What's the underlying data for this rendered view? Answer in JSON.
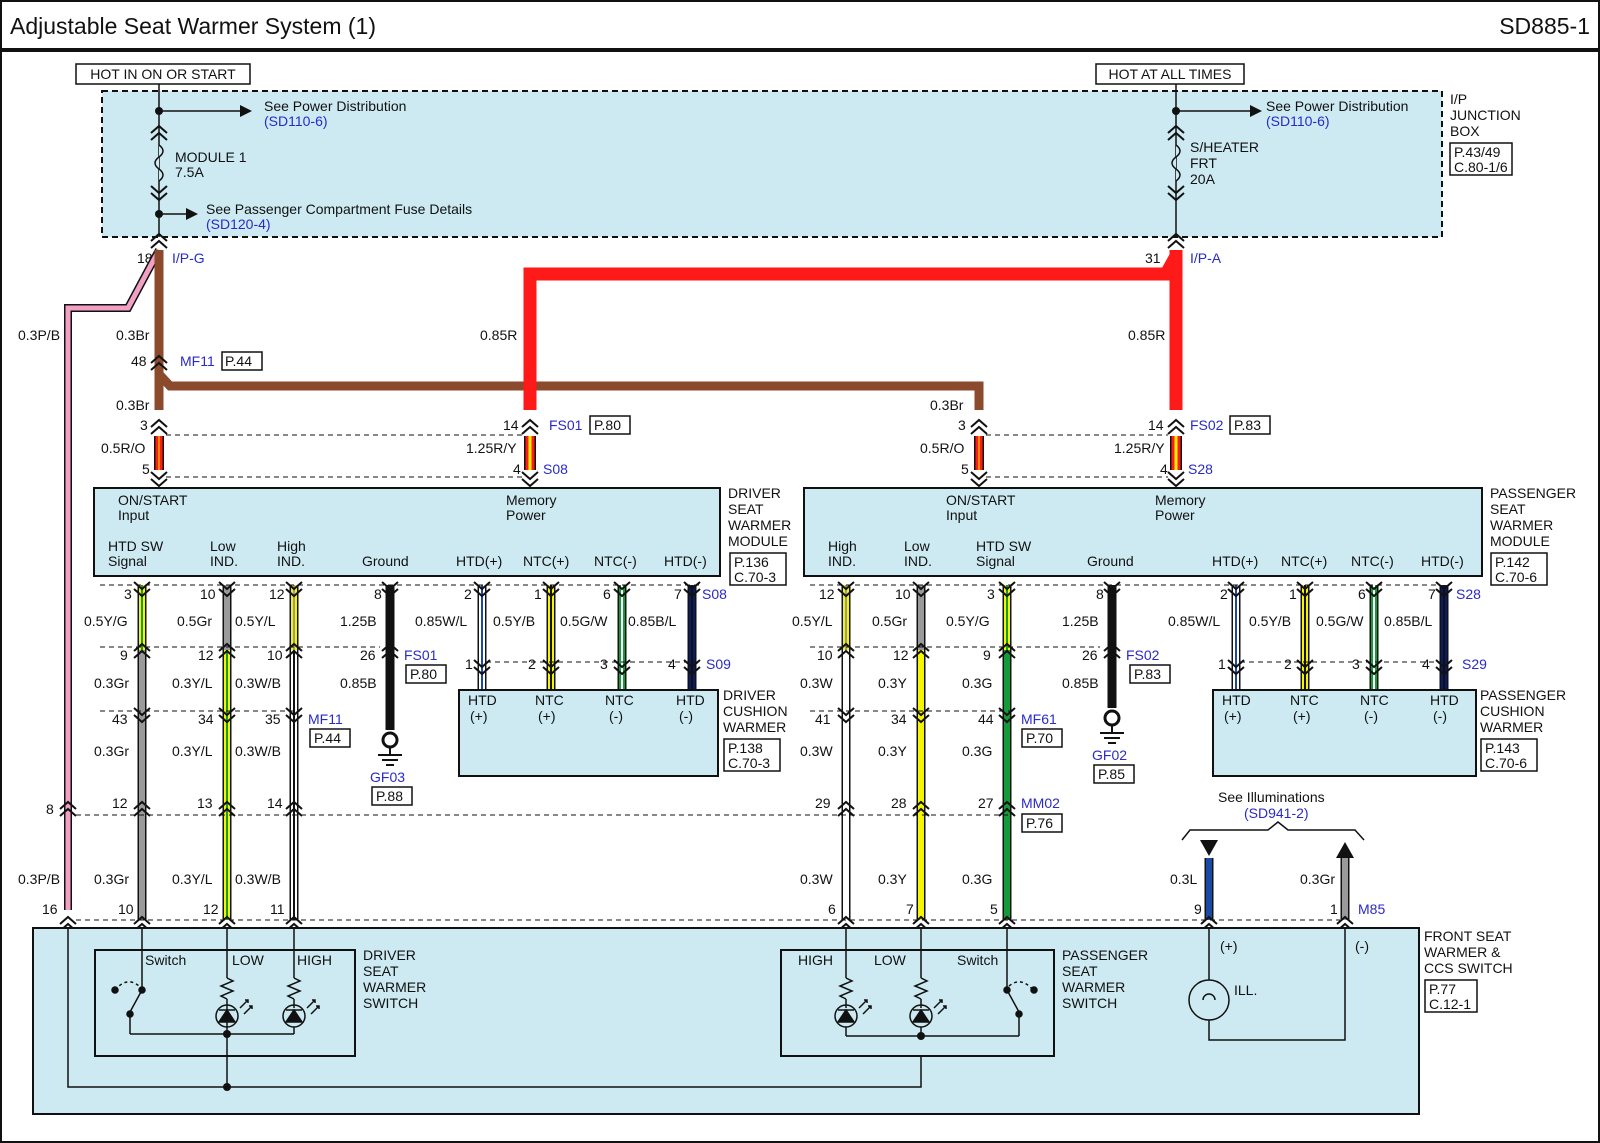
{
  "header": {
    "title": "Adjustable Seat Warmer System (1)",
    "code": "SD885-1"
  },
  "colors": {
    "panel": "#cdeaf2",
    "brown": "#8b4a2b",
    "red": "#ff1a1a",
    "pink": "#f2a0c4",
    "blue_text": "#2a2ac8",
    "yellow": "#f5f500",
    "green": "#139a3a",
    "gray": "#9a9a9a",
    "navy": "#0a1a6a",
    "light_blue": "#1a4aa6"
  },
  "power": {
    "hot_on_start": "HOT IN ON OR START",
    "hot_all": "HOT AT ALL TIMES",
    "see_power": "See Power Distribution",
    "sd110": "(SD110-6)",
    "module_fuse": "MODULE 1",
    "module_amp": "7.5A",
    "see_fuse": "See Passenger Compartment Fuse Details",
    "sd120": "(SD120-4)",
    "heater_fuse_1": "S/HEATER",
    "heater_fuse_2": "FRT",
    "heater_amp": "20A",
    "ipj_1": "I/P",
    "ipj_2": "JUNCTION",
    "ipj_3": "BOX",
    "ipj_ref_1": "P.43/49",
    "ipj_ref_2": "C.80-1/6"
  },
  "connectors": {
    "ipg": "I/P-G",
    "ipa": "I/P-A",
    "mf11": "MF11",
    "p44": "P.44",
    "fs01": "FS01",
    "p80": "P.80",
    "fs02": "FS02",
    "p83": "P.83",
    "s08": "S08",
    "s28": "S28",
    "s09": "S09",
    "s29": "S29",
    "mf61": "MF61",
    "p70": "P.70",
    "mm02": "MM02",
    "p76": "P.76",
    "gf03": "GF03",
    "p88": "P.88",
    "gf02": "GF02",
    "p85": "P.85",
    "m85": "M85"
  },
  "pins": {
    "p18": "18",
    "p31": "31",
    "p48": "48",
    "p3": "3",
    "p14": "14",
    "p5": "5",
    "p4": "4",
    "p12": "12",
    "p10": "10",
    "p8": "8",
    "p2": "2",
    "p1": "1",
    "p6": "6",
    "p7": "7",
    "p9": "9",
    "p26": "26",
    "p43": "43",
    "p34": "34",
    "p35": "35",
    "p41": "41",
    "p44": "44",
    "p13": "13",
    "p29": "29",
    "p28": "28",
    "p27": "27",
    "p16": "16",
    "p11": "11"
  },
  "wires": {
    "w03pb": "0.3P/B",
    "w03br": "0.3Br",
    "w085r": "0.85R",
    "w05ro": "0.5R/O",
    "w125ry": "1.25R/Y",
    "w05yg": "0.5Y/G",
    "w05gr": "0.5Gr",
    "w05yl": "0.5Y/L",
    "w125b": "1.25B",
    "w085wl": "0.85W/L",
    "w05yb": "0.5Y/B",
    "w05gw": "0.5G/W",
    "w085bl": "0.85B/L",
    "w03gr": "0.3Gr",
    "w03yl": "0.3Y/L",
    "w03wb": "0.3W/B",
    "w085b": "0.85B",
    "w03w": "0.3W",
    "w03y": "0.3Y",
    "w03g": "0.3G",
    "w03l": "0.3L"
  },
  "driver_module": {
    "on_start_1": "ON/START",
    "on_start_2": "Input",
    "mem_1": "Memory",
    "mem_2": "Power",
    "htdsw_1": "HTD SW",
    "htdsw_2": "Signal",
    "low_1": "Low",
    "low_2": "IND.",
    "high_1": "High",
    "high_2": "IND.",
    "ground": "Ground",
    "htdp": "HTD(+)",
    "ntcp": "NTC(+)",
    "ntcm": "NTC(-)",
    "htdm": "HTD(-)",
    "name_1": "DRIVER",
    "name_2": "SEAT",
    "name_3": "WARMER",
    "name_4": "MODULE",
    "ref_1": "P.136",
    "ref_2": "C.70-3"
  },
  "passenger_module": {
    "on_start_1": "ON/START",
    "on_start_2": "Input",
    "mem_1": "Memory",
    "mem_2": "Power",
    "high_1": "High",
    "high_2": "IND.",
    "low_1": "Low",
    "low_2": "IND.",
    "htdsw_1": "HTD SW",
    "htdsw_2": "Signal",
    "ground": "Ground",
    "htdp": "HTD(+)",
    "ntcp": "NTC(+)",
    "ntcm": "NTC(-)",
    "htdm": "HTD(-)",
    "name_1": "PASSENGER",
    "name_2": "SEAT",
    "name_3": "WARMER",
    "name_4": "MODULE",
    "ref_1": "P.142",
    "ref_2": "C.70-6"
  },
  "driver_cushion": {
    "htd": "HTD",
    "ntc": "NTC",
    "plus": "(+)",
    "minus": "(-)",
    "name_1": "DRIVER",
    "name_2": "CUSHION",
    "name_3": "WARMER",
    "ref_1": "P.138",
    "ref_2": "C.70-3"
  },
  "passenger_cushion": {
    "htd": "HTD",
    "ntc": "NTC",
    "plus": "(+)",
    "minus": "(-)",
    "name_1": "PASSENGER",
    "name_2": "CUSHION",
    "name_3": "WARMER",
    "ref_1": "P.143",
    "ref_2": "C.70-6"
  },
  "illum": {
    "see": "See Illuminations",
    "ref": "(SD941-2)",
    "plus": "(+)",
    "minus": "(-)",
    "ill": "ILL."
  },
  "switch_box": {
    "switch": "Switch",
    "low": "LOW",
    "high": "HIGH",
    "drv_1": "DRIVER",
    "drv_2": "SEAT",
    "drv_3": "WARMER",
    "drv_4": "SWITCH",
    "pas_1": "PASSENGER",
    "pas_2": "SEAT",
    "pas_3": "WARMER",
    "pas_4": "SWITCH",
    "name_1": "FRONT SEAT",
    "name_2": "WARMER &",
    "name_3": "CCS SWITCH",
    "ref_1": "P.77",
    "ref_2": "C.12-1"
  }
}
